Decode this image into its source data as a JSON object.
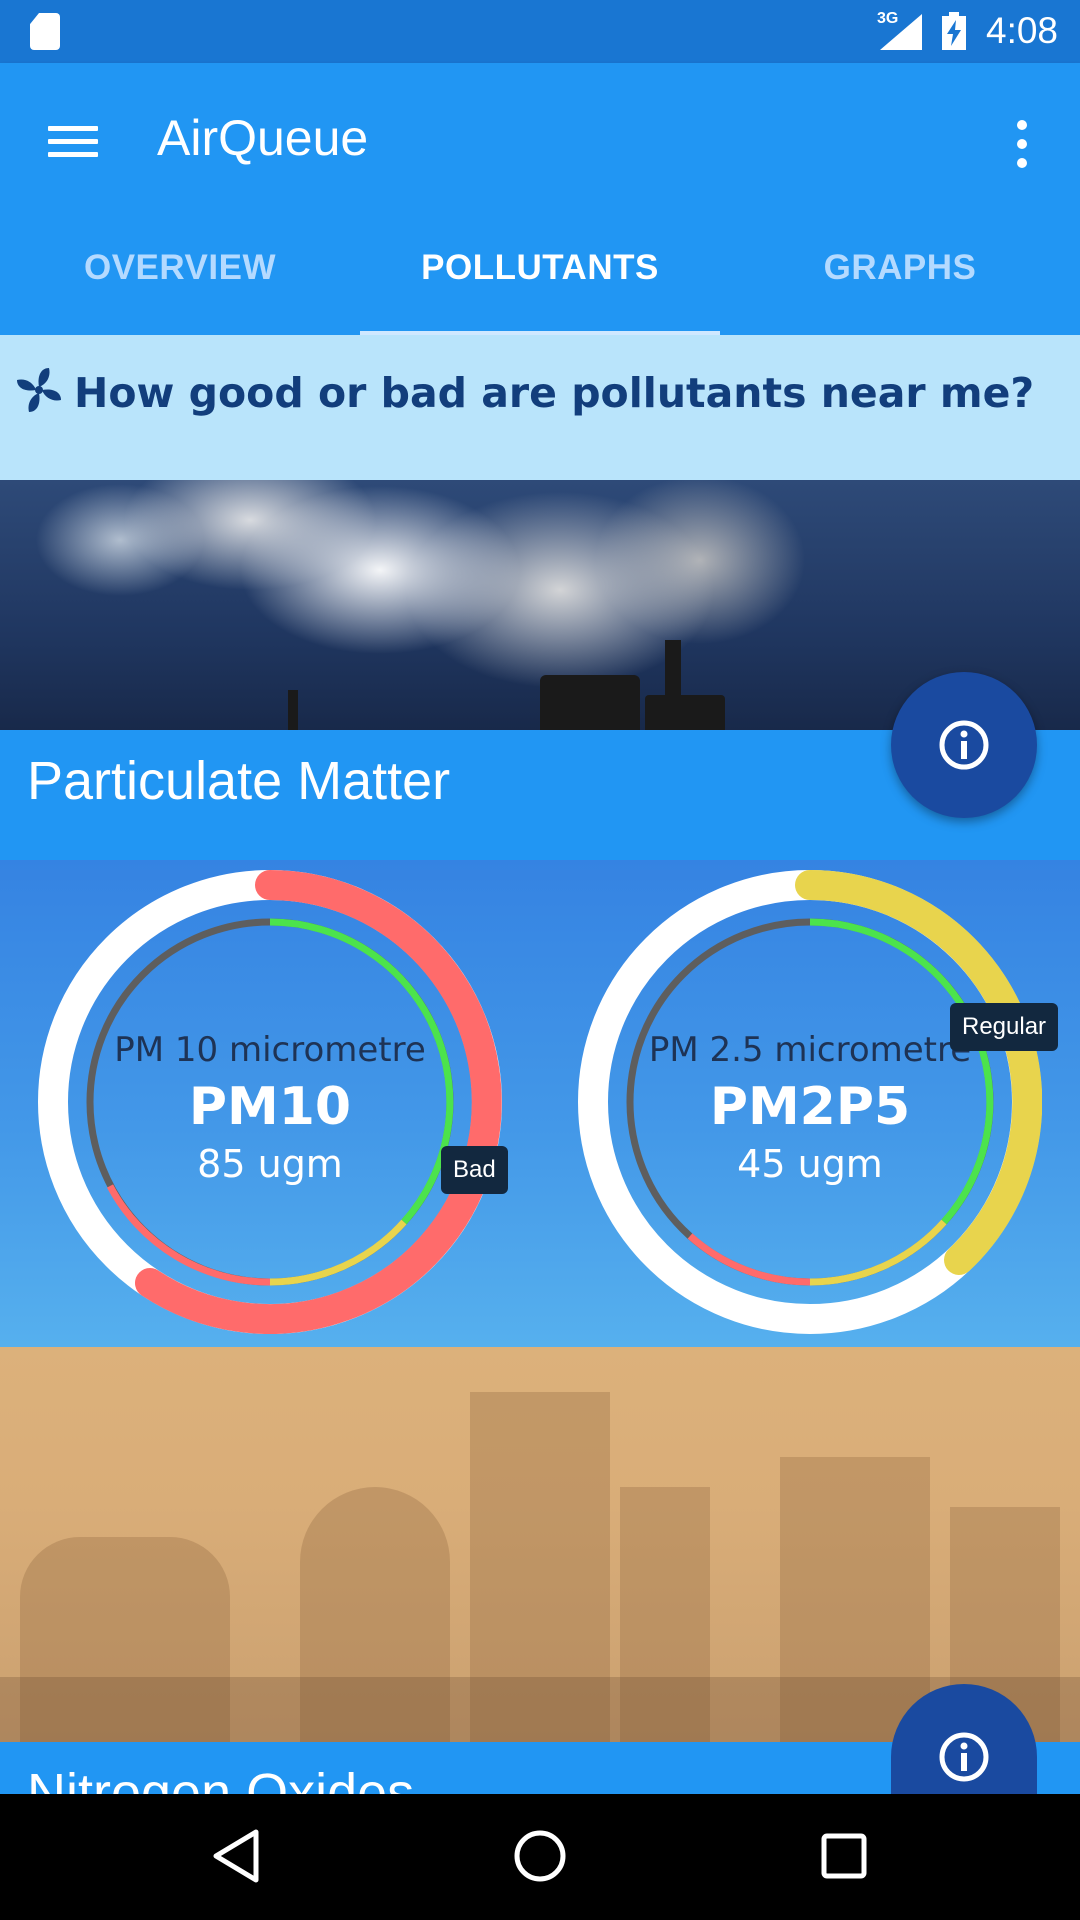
{
  "status_bar": {
    "network": "3G",
    "time": "4:08"
  },
  "app_bar": {
    "title": "AirQueue"
  },
  "tabs": [
    {
      "label": "OVERVIEW"
    },
    {
      "label": "POLLUTANTS"
    },
    {
      "label": "GRAPHS"
    }
  ],
  "active_tab": "POLLUTANTS",
  "question": {
    "text": "How good or bad are pollutants near me?"
  },
  "sections": [
    {
      "title": "Particulate Matter"
    },
    {
      "title": "Nitrogen Oxides"
    }
  ],
  "gauges": [
    {
      "subtitle": "PM 10 micrometre",
      "code": "PM10",
      "value": "85 ugm",
      "status": "Bad",
      "status_color": "#ff6b6b"
    },
    {
      "subtitle": "PM 2.5 micrometre",
      "code": "PM2P5",
      "value": "45 ugm",
      "status": "Regular",
      "status_color": "#e8d44d"
    }
  ],
  "colors": {
    "primary": "#2196f3",
    "primary_dark": "#1976d2",
    "fab": "#1a4aa0",
    "good": "#4ce34c",
    "regular": "#e8d44d",
    "bad": "#ff6b6b"
  },
  "icons": [
    "sd-card-icon",
    "signal-icon",
    "battery-charging-icon",
    "menu-icon",
    "more-vert-icon",
    "fan-icon",
    "info-icon",
    "back-icon",
    "home-icon",
    "recents-icon"
  ]
}
